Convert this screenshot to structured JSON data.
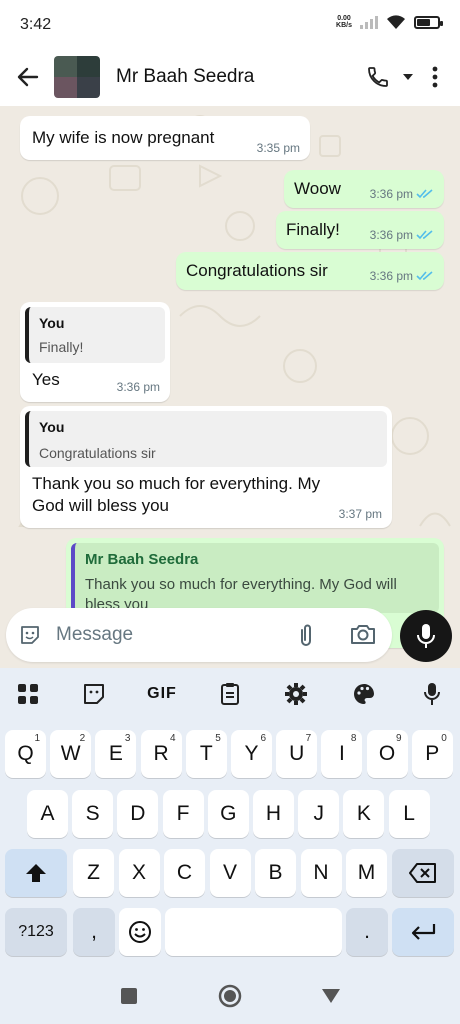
{
  "status_bar": {
    "time": "3:42",
    "net_speed_value": "0.00",
    "net_speed_unit": "KB/s",
    "battery_level": 0.65
  },
  "header": {
    "contact_name": "Mr Baah Seedra",
    "avatar_colors": [
      "#4a5a52",
      "#2d3d3a",
      "#6b5560",
      "#3a4048"
    ]
  },
  "messages": [
    {
      "direction": "in",
      "text": "My wife is now pregnant",
      "time": "3:35 pm"
    },
    {
      "direction": "out",
      "text": "Woow",
      "time": "3:36 pm",
      "read": true
    },
    {
      "direction": "out",
      "text": "Finally!",
      "time": "3:36 pm",
      "read": true
    },
    {
      "direction": "out",
      "text": "Congratulations sir",
      "time": "3:36 pm",
      "read": true
    },
    {
      "direction": "in",
      "quote_name": "You",
      "quote_text": "Finally!",
      "text": "Yes",
      "time": "3:36 pm"
    },
    {
      "direction": "in",
      "quote_name": "You",
      "quote_text": "Congratulations sir",
      "text_line1": "Thank you so much for everything. My",
      "text_line2": "God will bless you",
      "time": "3:37 pm"
    },
    {
      "direction": "out",
      "quote_name": "Mr Baah Seedra",
      "quote_text": "Thank you so much for everything. My God will bless you"
    }
  ],
  "composer": {
    "placeholder": "Message"
  },
  "keyboard": {
    "toolbar": [
      "apps-icon",
      "sticker-icon",
      "GIF",
      "clipboard-icon",
      "settings-icon",
      "palette-icon",
      "mic-icon"
    ],
    "gif_label": "GIF",
    "row1": [
      {
        "k": "Q",
        "n": "1"
      },
      {
        "k": "W",
        "n": "2"
      },
      {
        "k": "E",
        "n": "3"
      },
      {
        "k": "R",
        "n": "4"
      },
      {
        "k": "T",
        "n": "5"
      },
      {
        "k": "Y",
        "n": "6"
      },
      {
        "k": "U",
        "n": "7"
      },
      {
        "k": "I",
        "n": "8"
      },
      {
        "k": "O",
        "n": "9"
      },
      {
        "k": "P",
        "n": "0"
      }
    ],
    "row2": [
      "A",
      "S",
      "D",
      "F",
      "G",
      "H",
      "J",
      "K",
      "L"
    ],
    "row3": [
      "Z",
      "X",
      "C",
      "V",
      "B",
      "N",
      "M"
    ],
    "symbols_label": "?123",
    "comma_label": ",",
    "period_label": "."
  },
  "colors": {
    "chat_background": "#efeae2",
    "outgoing_bubble": "#d9fdd3",
    "read_ticks": "#53bdeb",
    "keyboard_background": "#e8eef6"
  }
}
